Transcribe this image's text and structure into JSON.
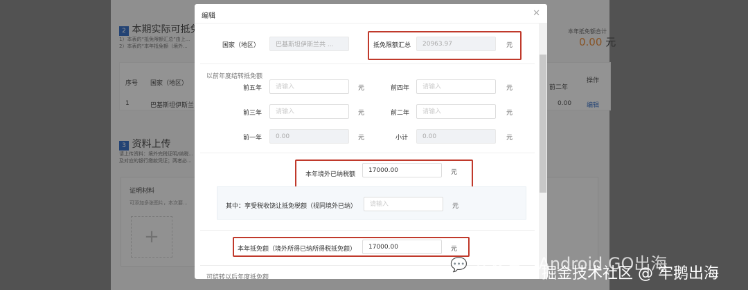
{
  "background": {
    "section2": {
      "number": "2",
      "title": "本期实际可抵免...",
      "notes": [
        "1）本表的“抵免限额汇总”由上...",
        "2）本表的“本年抵免额（境外..."
      ]
    },
    "total": {
      "label": "本年抵免额合计",
      "value": "0.00",
      "unit": "元"
    },
    "table": {
      "headers": [
        "序号",
        "国家（地区）",
        "前二年",
        "操作"
      ],
      "row": {
        "index": "1",
        "country": "巴基斯坦伊斯兰...",
        "value": "0.00",
        "action": "编辑"
      }
    },
    "section3": {
      "number": "3",
      "title": "资料上传",
      "notes": [
        "请上传资料：境外完税证明/纳税...",
        "及对应的银行缴款凭证；两者必..."
      ]
    },
    "upload": {
      "title": "证明材料",
      "hint": "可添加多张图片，本次要..."
    }
  },
  "modal": {
    "title": "编辑",
    "country": {
      "label": "国家（地区）",
      "value": "巴基斯坦伊斯兰共 ..."
    },
    "limit_total": {
      "label": "抵免限额汇总",
      "value": "20963.97",
      "unit": "元"
    },
    "carry_section": "以前年度结转抵免额",
    "placeholder": "请输入",
    "fields": [
      {
        "label": "前五年",
        "value": "",
        "unit": "元"
      },
      {
        "label": "前四年",
        "value": "",
        "unit": "元"
      },
      {
        "label": "前三年",
        "value": "",
        "unit": "元"
      },
      {
        "label": "前二年",
        "value": "",
        "unit": "元"
      },
      {
        "label": "前一年",
        "value": "0.00",
        "unit": "元"
      },
      {
        "label": "小计",
        "value": "0.00",
        "unit": "元"
      }
    ],
    "foreign_tax_paid": {
      "label": "本年境外已纳税额",
      "value": "17000.00",
      "unit": "元"
    },
    "tax_sparing": {
      "label": "其中：享受税收饶让抵免税额（视同境外已纳）",
      "value": "",
      "unit": "元"
    },
    "credit_this_year": {
      "label": "本年抵免额（境外所得已纳所得税抵免额）",
      "value": "17000.00",
      "unit": "元"
    },
    "carry_forward": "可结转以后年度抵免额"
  },
  "watermark": {
    "line1": "公众号 · Android GO出海",
    "line2": "掘金技术社区 @ 牢鹅出海"
  }
}
